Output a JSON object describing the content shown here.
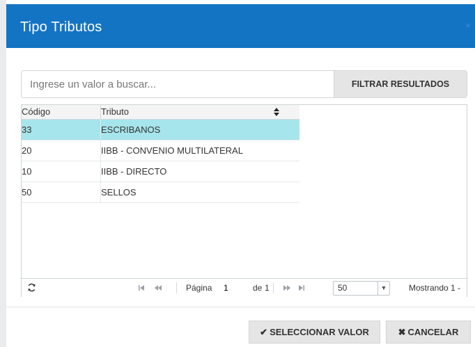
{
  "dialog": {
    "title": "Tipo Tributos",
    "close_glyph": "×"
  },
  "search": {
    "placeholder": "Ingrese un valor a buscar...",
    "filter_label": "FILTRAR RESULTADOS"
  },
  "grid": {
    "columns": [
      "Código",
      "Tributo"
    ],
    "rows": [
      {
        "codigo": "33",
        "tributo": "ESCRIBANOS",
        "selected": true
      },
      {
        "codigo": "20",
        "tributo": "IIBB - CONVENIO MULTILATERAL",
        "selected": false
      },
      {
        "codigo": "10",
        "tributo": "IIBB - DIRECTO",
        "selected": false
      },
      {
        "codigo": "50",
        "tributo": "SELLOS",
        "selected": false
      }
    ]
  },
  "pager": {
    "page_label": "Página",
    "page_value": "1",
    "of_label": "de",
    "total_pages": "1",
    "page_size": "50",
    "showing": "Mostrando 1 -"
  },
  "footer": {
    "select_label": "SELECCIONAR VALOR",
    "cancel_label": "CANCELAR"
  },
  "colors": {
    "header_bg": "#1474c4",
    "selected_row": "#a6e5ec",
    "button_bg": "#e5e5e5"
  },
  "icons": {
    "refresh": "refresh-icon",
    "first": "first-page-icon",
    "prev": "prev-page-icon",
    "next": "next-page-icon",
    "last": "last-page-icon",
    "sort": "sort-icon",
    "check": "check-icon",
    "cancel": "x-icon"
  }
}
